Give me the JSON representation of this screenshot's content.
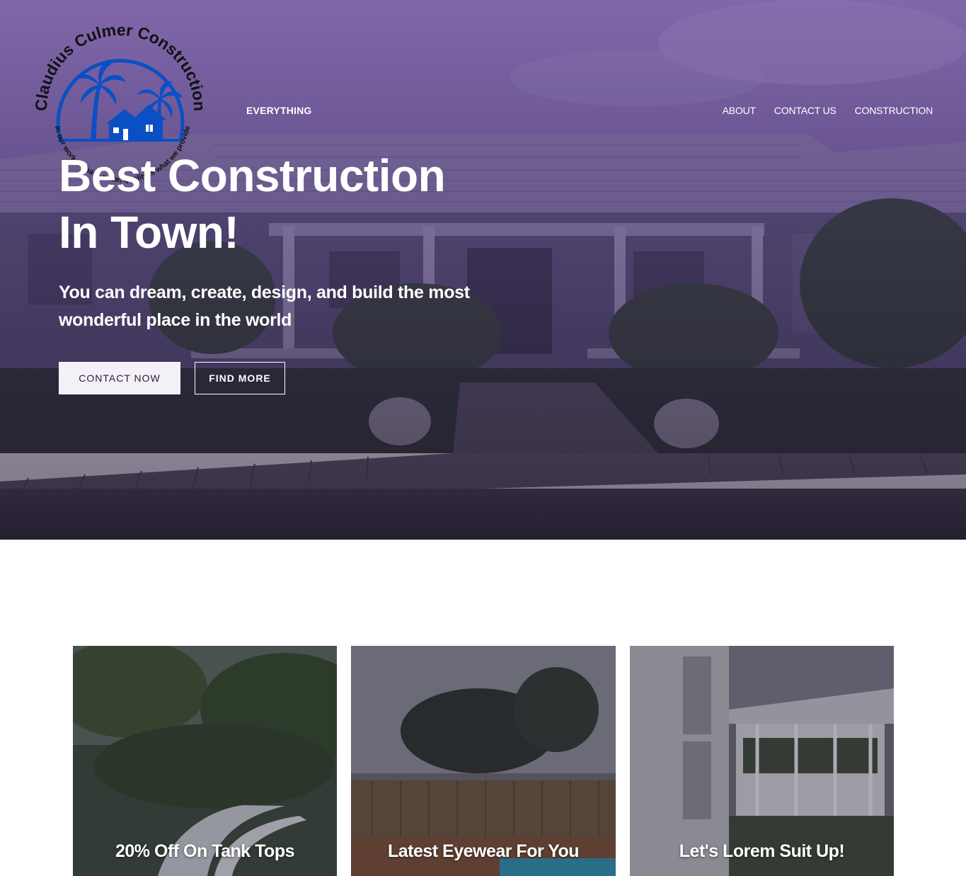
{
  "brand": {
    "name": "Claudius Culmer Construction",
    "tagline": "In our work we have pride, Quality is what we provide"
  },
  "nav": {
    "left_item": "EVERYTHING",
    "items": [
      {
        "label": "ABOUT"
      },
      {
        "label": "CONTACT US"
      },
      {
        "label": "CONSTRUCTION"
      }
    ]
  },
  "hero": {
    "title_line1": "Best Construction",
    "title_line2": "In Town!",
    "subtitle_line1": "You can dream, create, design, and build the most",
    "subtitle_line2": "wonderful place in the world",
    "primary_button": "CONTACT NOW",
    "secondary_button": "FIND MORE"
  },
  "cards": [
    {
      "title": "20% Off On Tank Tops"
    },
    {
      "title": "Latest Eyewear For You"
    },
    {
      "title": "Let's Lorem Suit Up!"
    }
  ],
  "colors": {
    "hero_overlay": "#6b4e97",
    "logo_blue": "#0b4fc4",
    "button_light": "#f3f0f7",
    "button_text": "#2b2233"
  }
}
